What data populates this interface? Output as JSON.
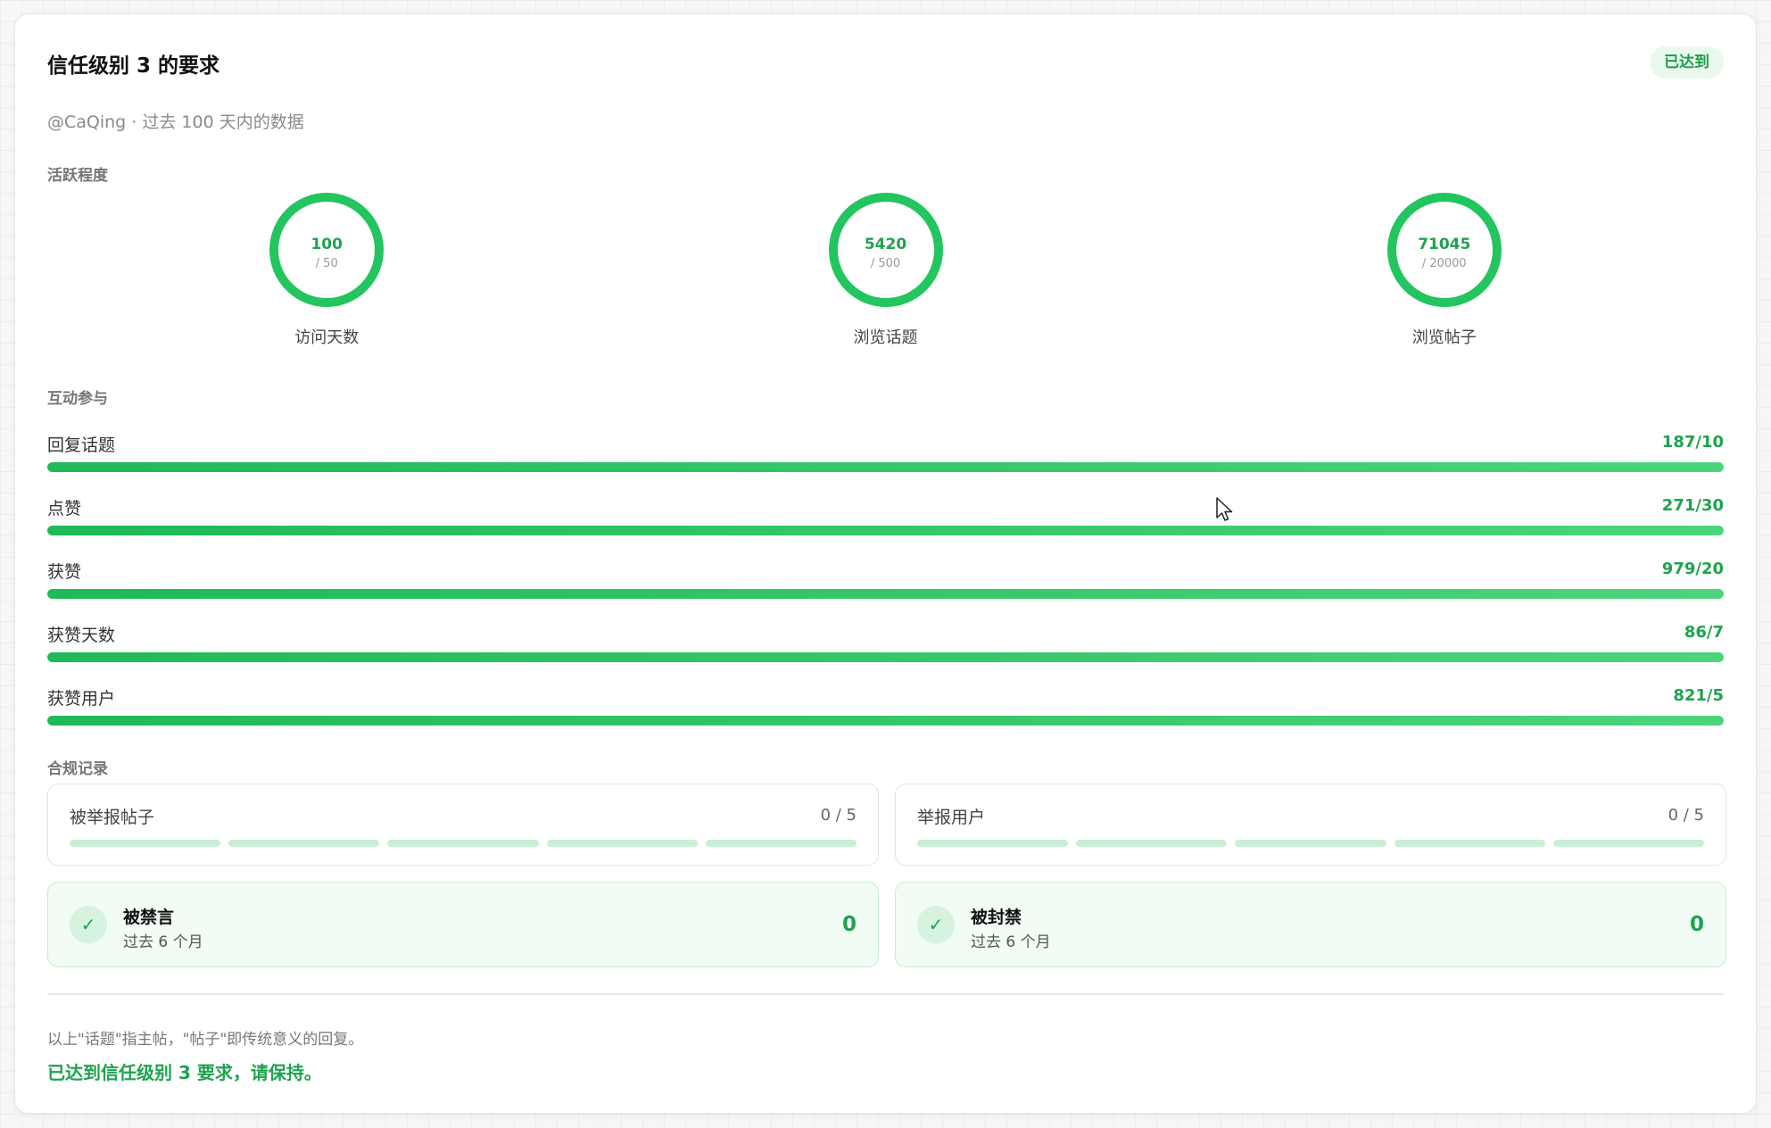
{
  "header": {
    "title": "信任级别 3 的要求",
    "badge": "已达到",
    "subtitle": "@CaQing · 过去 100 天内的数据"
  },
  "activity": {
    "label": "活跃程度",
    "rings": [
      {
        "value": "100",
        "target": "/ 50",
        "label": "访问天数"
      },
      {
        "value": "5420",
        "target": "/ 500",
        "label": "浏览话题"
      },
      {
        "value": "71045",
        "target": "/ 20000",
        "label": "浏览帖子"
      }
    ]
  },
  "interaction": {
    "label": "互动参与",
    "bars": [
      {
        "label": "回复话题",
        "value": "187/10",
        "progress": 1.0
      },
      {
        "label": "点赞",
        "value": "271/30",
        "progress": 1.0
      },
      {
        "label": "获赞",
        "value": "979/20",
        "progress": 1.0
      },
      {
        "label": "获赞天数",
        "value": "86/7",
        "progress": 1.0
      },
      {
        "label": "获赞用户",
        "value": "821/5",
        "progress": 1.0
      }
    ]
  },
  "compliance": {
    "label": "合规记录",
    "reports": [
      {
        "label": "被举报帖子",
        "value": "0 / 5",
        "used": 0,
        "max": 5
      },
      {
        "label": "举报用户",
        "value": "0 / 5",
        "used": 0,
        "max": 5
      }
    ],
    "penalties": [
      {
        "title": "被禁言",
        "sub": "过去 6 个月",
        "value": "0"
      },
      {
        "title": "被封禁",
        "sub": "过去 6 个月",
        "value": "0"
      }
    ]
  },
  "footer": {
    "note": "以上\"话题\"指主帖，\"帖子\"即传统意义的回复。",
    "status": "已达到信任级别 3 要求，请保持。"
  },
  "colors": {
    "accent": "#22c55e",
    "accent_text": "#1ea34f",
    "segment": "#c9efd6"
  }
}
